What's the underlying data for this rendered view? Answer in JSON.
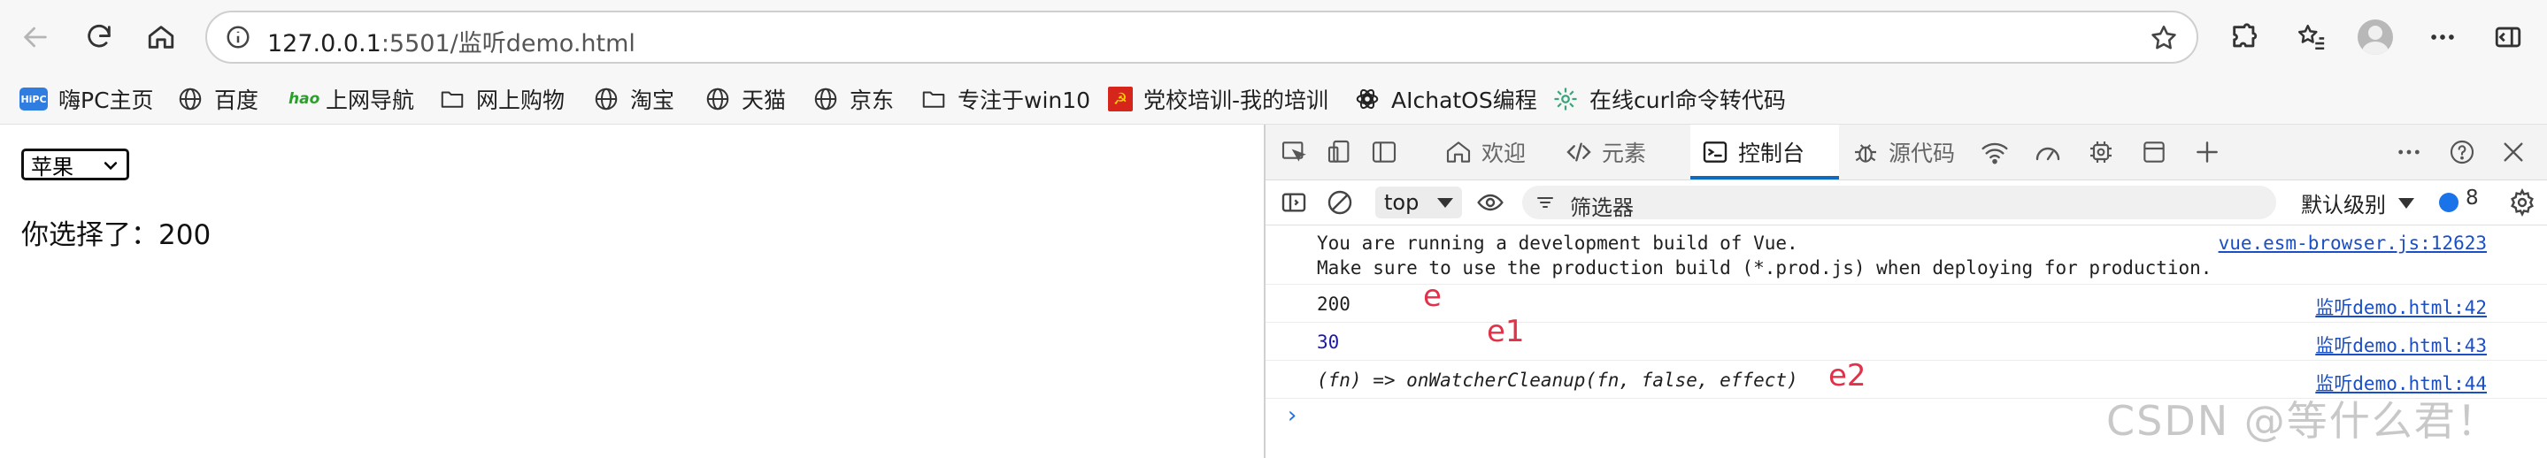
{
  "browser": {
    "url_host": "127.0.0.1",
    "url_rest": ":5501/监听demo.html"
  },
  "bookmarks": [
    {
      "label": "嗨PC主页",
      "icon": "hipc-logo-icon"
    },
    {
      "label": "百度",
      "icon": "globe-icon"
    },
    {
      "label": "上网导航",
      "icon": "hao-logo-icon"
    },
    {
      "label": "网上购物",
      "icon": "folder-icon"
    },
    {
      "label": "淘宝",
      "icon": "globe-icon"
    },
    {
      "label": "天猫",
      "icon": "globe-icon"
    },
    {
      "label": "京东",
      "icon": "globe-icon"
    },
    {
      "label": "专注于win10",
      "icon": "folder-icon"
    },
    {
      "label": "党校培训-我的培训",
      "icon": "party-emblem-icon"
    },
    {
      "label": "AIchatOS编程",
      "icon": "openai-icon"
    },
    {
      "label": "在线curl命令转代码",
      "icon": "gear-flower-icon"
    }
  ],
  "page": {
    "select_value": "苹果",
    "result_text": "你选择了：200"
  },
  "devtools": {
    "tabs": [
      {
        "label": "欢迎",
        "icon": "home-icon"
      },
      {
        "label": "元素",
        "icon": "code-icon"
      },
      {
        "label": "控制台",
        "icon": "console-icon"
      },
      {
        "label": "源代码",
        "icon": "bug-icon"
      }
    ],
    "context": "top",
    "filter_placeholder": "筛选器",
    "levels": "默认级别",
    "message_count": "8",
    "logs": [
      {
        "line1": "You are running a development build of Vue.",
        "line2": "Make sure to use the production build (*.prod.js) when deploying for production.",
        "source": "vue.esm-browser.js:12623"
      },
      {
        "value": "200",
        "source": "监听demo.html:42",
        "annotation": "e"
      },
      {
        "value": "30",
        "source": "监听demo.html:43",
        "annotation": "e1"
      },
      {
        "value": "(fn) => onWatcherCleanup(fn, false, effect)",
        "source": "监听demo.html:44",
        "annotation": "e2"
      }
    ],
    "prompt": "›"
  },
  "watermark": "CSDN @等什么君！",
  "colors": {
    "accent": "#0f6cbd",
    "link": "#1a4fc7",
    "number": "#1a1aa6",
    "annotation": "#e0334a"
  }
}
